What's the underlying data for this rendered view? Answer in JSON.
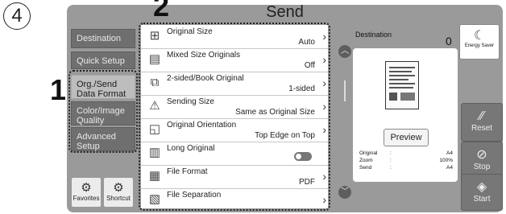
{
  "callouts": {
    "step": "4",
    "one": "1",
    "two": "2"
  },
  "screen": {
    "title": "Send"
  },
  "nav": {
    "destination": "Destination",
    "quick_setup": "Quick Setup",
    "org_send": "Org./Send Data Format",
    "color_image": "Color/Image Quality",
    "advanced": "Advanced Setup",
    "favorites": "Favorites",
    "shortcut": "Shortcut"
  },
  "settings": [
    {
      "label": "Original Size",
      "value": "Auto",
      "icon": "page-size-icon"
    },
    {
      "label": "Mixed Size Originals",
      "value": "Off",
      "icon": "mixed-originals-icon"
    },
    {
      "label": "2-sided/Book Original",
      "value": "1-sided",
      "icon": "duplex-icon"
    },
    {
      "label": "Sending Size",
      "value": "Same as Original Size",
      "icon": "sending-size-icon"
    },
    {
      "label": "Original Orientation",
      "value": "Top Edge on Top",
      "icon": "orientation-icon"
    },
    {
      "label": "Long Original",
      "value": "",
      "icon": "long-original-icon"
    },
    {
      "label": "File Format",
      "value": "PDF",
      "icon": "file-format-icon"
    },
    {
      "label": "File Separation",
      "value": "",
      "icon": "file-separation-icon"
    }
  ],
  "destination": {
    "label": "Destination",
    "count": "0"
  },
  "preview": {
    "button": "Preview"
  },
  "info": [
    {
      "label": "Original",
      "value": "A4"
    },
    {
      "label": "Zoom",
      "value": "100%"
    },
    {
      "label": "Send",
      "value": "A4"
    }
  ],
  "side": {
    "energy_saver": "Energy Saver",
    "reset": "Reset",
    "stop": "Stop",
    "start": "Start"
  },
  "colors": {
    "panel": "#9a9a9a",
    "nav_dark": "#6f6f6f",
    "nav_light": "#bdbdbd",
    "side_button": "#777777"
  }
}
